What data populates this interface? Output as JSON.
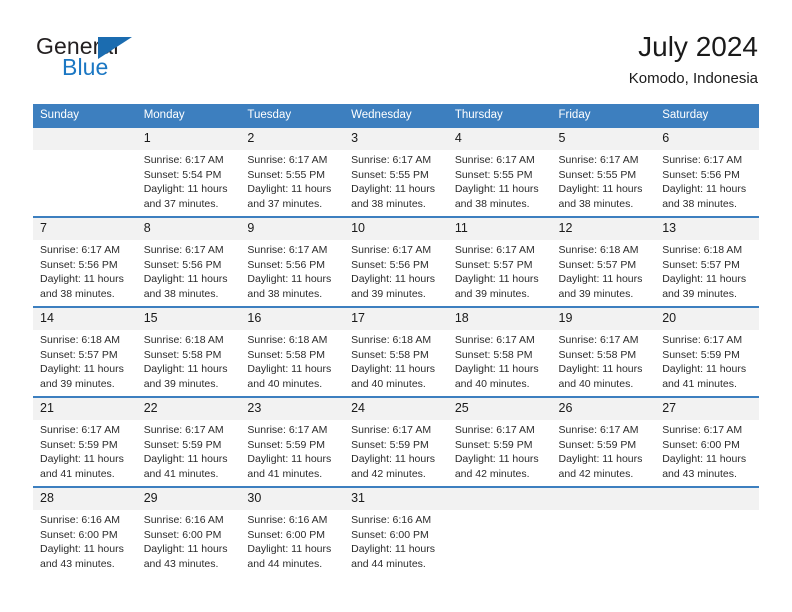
{
  "brand": {
    "name_top": "General",
    "name_bottom": "Blue",
    "triangle_color": "#1b6cb0",
    "blue_color": "#1b77c3"
  },
  "header": {
    "title": "July 2024",
    "subtitle": "Komodo, Indonesia"
  },
  "theme": {
    "header_blue": "#3d7fbf",
    "daynum_band": "#f2f2f2",
    "text": "#2b2b2b"
  },
  "weekdays": [
    "Sunday",
    "Monday",
    "Tuesday",
    "Wednesday",
    "Thursday",
    "Friday",
    "Saturday"
  ],
  "weeks": [
    [
      {
        "day": "",
        "sunrise": "",
        "sunset": "",
        "daylight_1": "",
        "daylight_2": ""
      },
      {
        "day": "1",
        "sunrise": "Sunrise: 6:17 AM",
        "sunset": "Sunset: 5:54 PM",
        "daylight_1": "Daylight: 11 hours",
        "daylight_2": "and 37 minutes."
      },
      {
        "day": "2",
        "sunrise": "Sunrise: 6:17 AM",
        "sunset": "Sunset: 5:55 PM",
        "daylight_1": "Daylight: 11 hours",
        "daylight_2": "and 37 minutes."
      },
      {
        "day": "3",
        "sunrise": "Sunrise: 6:17 AM",
        "sunset": "Sunset: 5:55 PM",
        "daylight_1": "Daylight: 11 hours",
        "daylight_2": "and 38 minutes."
      },
      {
        "day": "4",
        "sunrise": "Sunrise: 6:17 AM",
        "sunset": "Sunset: 5:55 PM",
        "daylight_1": "Daylight: 11 hours",
        "daylight_2": "and 38 minutes."
      },
      {
        "day": "5",
        "sunrise": "Sunrise: 6:17 AM",
        "sunset": "Sunset: 5:55 PM",
        "daylight_1": "Daylight: 11 hours",
        "daylight_2": "and 38 minutes."
      },
      {
        "day": "6",
        "sunrise": "Sunrise: 6:17 AM",
        "sunset": "Sunset: 5:56 PM",
        "daylight_1": "Daylight: 11 hours",
        "daylight_2": "and 38 minutes."
      }
    ],
    [
      {
        "day": "7",
        "sunrise": "Sunrise: 6:17 AM",
        "sunset": "Sunset: 5:56 PM",
        "daylight_1": "Daylight: 11 hours",
        "daylight_2": "and 38 minutes."
      },
      {
        "day": "8",
        "sunrise": "Sunrise: 6:17 AM",
        "sunset": "Sunset: 5:56 PM",
        "daylight_1": "Daylight: 11 hours",
        "daylight_2": "and 38 minutes."
      },
      {
        "day": "9",
        "sunrise": "Sunrise: 6:17 AM",
        "sunset": "Sunset: 5:56 PM",
        "daylight_1": "Daylight: 11 hours",
        "daylight_2": "and 38 minutes."
      },
      {
        "day": "10",
        "sunrise": "Sunrise: 6:17 AM",
        "sunset": "Sunset: 5:56 PM",
        "daylight_1": "Daylight: 11 hours",
        "daylight_2": "and 39 minutes."
      },
      {
        "day": "11",
        "sunrise": "Sunrise: 6:17 AM",
        "sunset": "Sunset: 5:57 PM",
        "daylight_1": "Daylight: 11 hours",
        "daylight_2": "and 39 minutes."
      },
      {
        "day": "12",
        "sunrise": "Sunrise: 6:18 AM",
        "sunset": "Sunset: 5:57 PM",
        "daylight_1": "Daylight: 11 hours",
        "daylight_2": "and 39 minutes."
      },
      {
        "day": "13",
        "sunrise": "Sunrise: 6:18 AM",
        "sunset": "Sunset: 5:57 PM",
        "daylight_1": "Daylight: 11 hours",
        "daylight_2": "and 39 minutes."
      }
    ],
    [
      {
        "day": "14",
        "sunrise": "Sunrise: 6:18 AM",
        "sunset": "Sunset: 5:57 PM",
        "daylight_1": "Daylight: 11 hours",
        "daylight_2": "and 39 minutes."
      },
      {
        "day": "15",
        "sunrise": "Sunrise: 6:18 AM",
        "sunset": "Sunset: 5:58 PM",
        "daylight_1": "Daylight: 11 hours",
        "daylight_2": "and 39 minutes."
      },
      {
        "day": "16",
        "sunrise": "Sunrise: 6:18 AM",
        "sunset": "Sunset: 5:58 PM",
        "daylight_1": "Daylight: 11 hours",
        "daylight_2": "and 40 minutes."
      },
      {
        "day": "17",
        "sunrise": "Sunrise: 6:18 AM",
        "sunset": "Sunset: 5:58 PM",
        "daylight_1": "Daylight: 11 hours",
        "daylight_2": "and 40 minutes."
      },
      {
        "day": "18",
        "sunrise": "Sunrise: 6:17 AM",
        "sunset": "Sunset: 5:58 PM",
        "daylight_1": "Daylight: 11 hours",
        "daylight_2": "and 40 minutes."
      },
      {
        "day": "19",
        "sunrise": "Sunrise: 6:17 AM",
        "sunset": "Sunset: 5:58 PM",
        "daylight_1": "Daylight: 11 hours",
        "daylight_2": "and 40 minutes."
      },
      {
        "day": "20",
        "sunrise": "Sunrise: 6:17 AM",
        "sunset": "Sunset: 5:59 PM",
        "daylight_1": "Daylight: 11 hours",
        "daylight_2": "and 41 minutes."
      }
    ],
    [
      {
        "day": "21",
        "sunrise": "Sunrise: 6:17 AM",
        "sunset": "Sunset: 5:59 PM",
        "daylight_1": "Daylight: 11 hours",
        "daylight_2": "and 41 minutes."
      },
      {
        "day": "22",
        "sunrise": "Sunrise: 6:17 AM",
        "sunset": "Sunset: 5:59 PM",
        "daylight_1": "Daylight: 11 hours",
        "daylight_2": "and 41 minutes."
      },
      {
        "day": "23",
        "sunrise": "Sunrise: 6:17 AM",
        "sunset": "Sunset: 5:59 PM",
        "daylight_1": "Daylight: 11 hours",
        "daylight_2": "and 41 minutes."
      },
      {
        "day": "24",
        "sunrise": "Sunrise: 6:17 AM",
        "sunset": "Sunset: 5:59 PM",
        "daylight_1": "Daylight: 11 hours",
        "daylight_2": "and 42 minutes."
      },
      {
        "day": "25",
        "sunrise": "Sunrise: 6:17 AM",
        "sunset": "Sunset: 5:59 PM",
        "daylight_1": "Daylight: 11 hours",
        "daylight_2": "and 42 minutes."
      },
      {
        "day": "26",
        "sunrise": "Sunrise: 6:17 AM",
        "sunset": "Sunset: 5:59 PM",
        "daylight_1": "Daylight: 11 hours",
        "daylight_2": "and 42 minutes."
      },
      {
        "day": "27",
        "sunrise": "Sunrise: 6:17 AM",
        "sunset": "Sunset: 6:00 PM",
        "daylight_1": "Daylight: 11 hours",
        "daylight_2": "and 43 minutes."
      }
    ],
    [
      {
        "day": "28",
        "sunrise": "Sunrise: 6:16 AM",
        "sunset": "Sunset: 6:00 PM",
        "daylight_1": "Daylight: 11 hours",
        "daylight_2": "and 43 minutes."
      },
      {
        "day": "29",
        "sunrise": "Sunrise: 6:16 AM",
        "sunset": "Sunset: 6:00 PM",
        "daylight_1": "Daylight: 11 hours",
        "daylight_2": "and 43 minutes."
      },
      {
        "day": "30",
        "sunrise": "Sunrise: 6:16 AM",
        "sunset": "Sunset: 6:00 PM",
        "daylight_1": "Daylight: 11 hours",
        "daylight_2": "and 44 minutes."
      },
      {
        "day": "31",
        "sunrise": "Sunrise: 6:16 AM",
        "sunset": "Sunset: 6:00 PM",
        "daylight_1": "Daylight: 11 hours",
        "daylight_2": "and 44 minutes."
      },
      {
        "day": "",
        "sunrise": "",
        "sunset": "",
        "daylight_1": "",
        "daylight_2": ""
      },
      {
        "day": "",
        "sunrise": "",
        "sunset": "",
        "daylight_1": "",
        "daylight_2": ""
      },
      {
        "day": "",
        "sunrise": "",
        "sunset": "",
        "daylight_1": "",
        "daylight_2": ""
      }
    ]
  ]
}
